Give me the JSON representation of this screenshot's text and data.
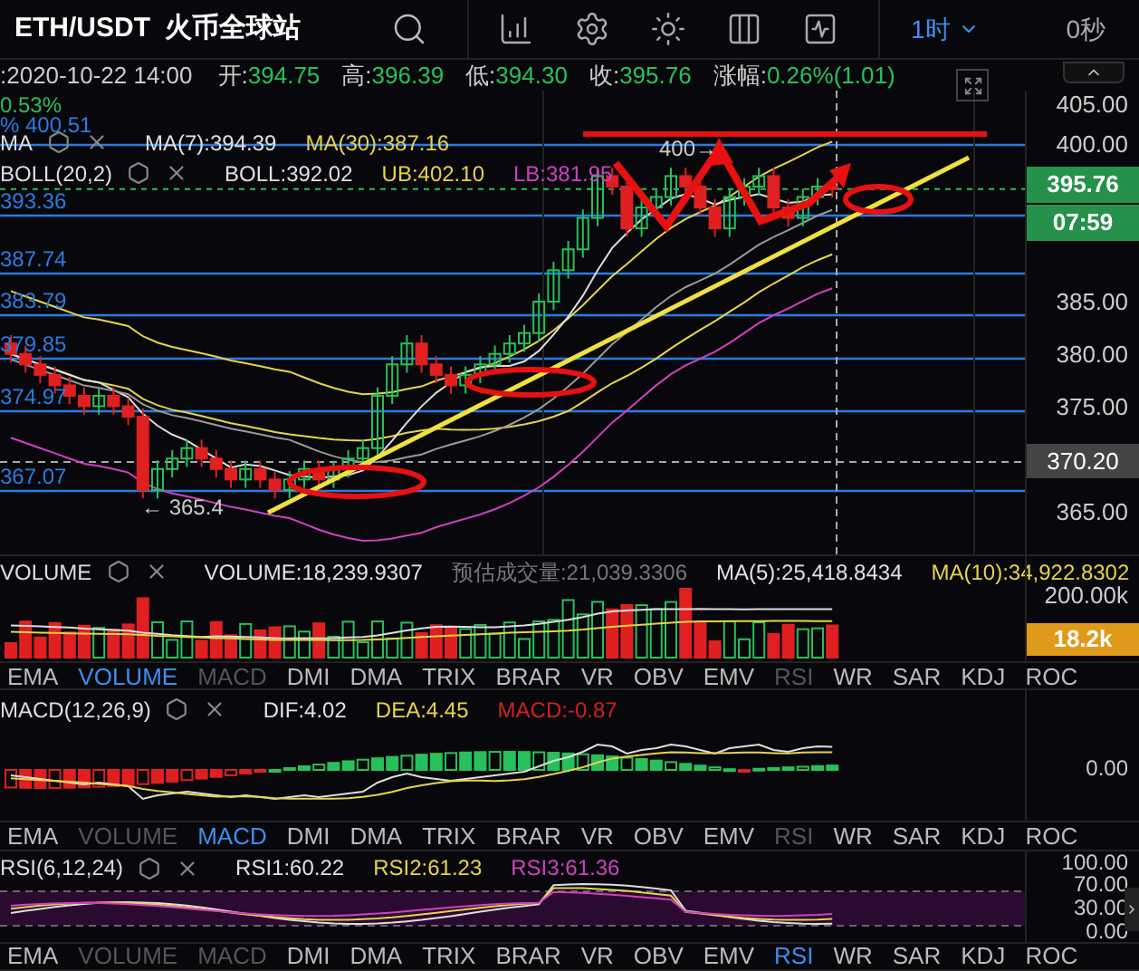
{
  "header": {
    "pair": "ETH/USDT",
    "exchange": "火币全球站",
    "interval": "1时",
    "countdown": "0秒"
  },
  "info": {
    "time": ":2020-10-22 14:00",
    "fields": [
      {
        "label": "开:",
        "value": "394.75"
      },
      {
        "label": "高:",
        "value": "396.39"
      },
      {
        "label": "低:",
        "value": "394.30"
      },
      {
        "label": "收:",
        "value": "395.76"
      },
      {
        "label": "涨幅:",
        "value": "0.26%(1.01)"
      }
    ]
  },
  "main": {
    "change": "0.53%",
    "fib_top": "% 400.51",
    "ma": {
      "name": "MA",
      "values": [
        {
          "text": "MA(7):394.39",
          "color": "#e0e0e0"
        },
        {
          "text": "MA(30):387.16",
          "color": "#e6d34a"
        }
      ]
    },
    "boll": {
      "name": "BOLL(20,2)",
      "values": [
        {
          "text": "BOLL:392.02",
          "color": "#e0e0e0"
        },
        {
          "text": "UB:402.10",
          "color": "#e6d34a"
        },
        {
          "text": "LB:381.95",
          "color": "#d040c0"
        }
      ]
    },
    "fib_levels": [
      "393.36",
      "387.74",
      "383.79",
      "379.85",
      "374.97",
      "367.07"
    ],
    "high_label": "400→",
    "low_label": "← 365.4",
    "price_axis": [
      "405.00",
      "400.00",
      "385.00",
      "380.00",
      "375.00",
      "365.00"
    ],
    "price_tag": "395.76",
    "countdown_tag": "07:59",
    "crosshair_tag": "370.20"
  },
  "volume": {
    "name": "VOLUME",
    "values": [
      {
        "text": "VOLUME:18,239.9307",
        "color": "#e0e0e0"
      },
      {
        "text": "预估成交量:21,039.3306",
        "color": "#777777"
      },
      {
        "text": "MA(5):25,418.8434",
        "color": "#e0e0e0"
      },
      {
        "text": "MA(10):34,922.8302",
        "color": "#e6d34a"
      }
    ],
    "axis": [
      "200.00k"
    ],
    "tag": "18.2k"
  },
  "tabs_1": [
    {
      "label": "EMA",
      "selected": false,
      "disabled": false
    },
    {
      "label": "VOLUME",
      "selected": true,
      "disabled": false
    },
    {
      "label": "MACD",
      "selected": false,
      "disabled": true
    },
    {
      "label": "DMI",
      "selected": false,
      "disabled": false
    },
    {
      "label": "DMA",
      "selected": false,
      "disabled": false
    },
    {
      "label": "TRIX",
      "selected": false,
      "disabled": false
    },
    {
      "label": "BRAR",
      "selected": false,
      "disabled": false
    },
    {
      "label": "VR",
      "selected": false,
      "disabled": false
    },
    {
      "label": "OBV",
      "selected": false,
      "disabled": false
    },
    {
      "label": "EMV",
      "selected": false,
      "disabled": false
    },
    {
      "label": "RSI",
      "selected": false,
      "disabled": true
    },
    {
      "label": "WR",
      "selected": false,
      "disabled": false
    },
    {
      "label": "SAR",
      "selected": false,
      "disabled": false
    },
    {
      "label": "KDJ",
      "selected": false,
      "disabled": false
    },
    {
      "label": "ROC",
      "selected": false,
      "disabled": false
    }
  ],
  "macd": {
    "name": "MACD(12,26,9)",
    "values": [
      {
        "text": "DIF:4.02",
        "color": "#e0e0e0"
      },
      {
        "text": "DEA:4.45",
        "color": "#e6d34a"
      },
      {
        "text": "MACD:-0.87",
        "color": "#d02020"
      }
    ],
    "axis": [
      "0.00"
    ]
  },
  "tabs_2": [
    {
      "label": "EMA",
      "selected": false,
      "disabled": false
    },
    {
      "label": "VOLUME",
      "selected": false,
      "disabled": true
    },
    {
      "label": "MACD",
      "selected": true,
      "disabled": false
    },
    {
      "label": "DMI",
      "selected": false,
      "disabled": false
    },
    {
      "label": "DMA",
      "selected": false,
      "disabled": false
    },
    {
      "label": "TRIX",
      "selected": false,
      "disabled": false
    },
    {
      "label": "BRAR",
      "selected": false,
      "disabled": false
    },
    {
      "label": "VR",
      "selected": false,
      "disabled": false
    },
    {
      "label": "OBV",
      "selected": false,
      "disabled": false
    },
    {
      "label": "EMV",
      "selected": false,
      "disabled": false
    },
    {
      "label": "RSI",
      "selected": false,
      "disabled": true
    },
    {
      "label": "WR",
      "selected": false,
      "disabled": false
    },
    {
      "label": "SAR",
      "selected": false,
      "disabled": false
    },
    {
      "label": "KDJ",
      "selected": false,
      "disabled": false
    },
    {
      "label": "ROC",
      "selected": false,
      "disabled": false
    }
  ],
  "rsi": {
    "name": "RSI(6,12,24)",
    "values": [
      {
        "text": "RSI1:60.22",
        "color": "#e0e0e0"
      },
      {
        "text": "RSI2:61.23",
        "color": "#e6d34a"
      },
      {
        "text": "RSI3:61.36",
        "color": "#d040c0"
      }
    ],
    "axis": [
      "100.00",
      "70.00",
      "30.00",
      "0.00"
    ]
  },
  "tabs_3": [
    {
      "label": "EMA",
      "selected": false,
      "disabled": false
    },
    {
      "label": "VOLUME",
      "selected": false,
      "disabled": true
    },
    {
      "label": "MACD",
      "selected": false,
      "disabled": true
    },
    {
      "label": "DMI",
      "selected": false,
      "disabled": false
    },
    {
      "label": "DMA",
      "selected": false,
      "disabled": false
    },
    {
      "label": "TRIX",
      "selected": false,
      "disabled": false
    },
    {
      "label": "BRAR",
      "selected": false,
      "disabled": false
    },
    {
      "label": "VR",
      "selected": false,
      "disabled": false
    },
    {
      "label": "OBV",
      "selected": false,
      "disabled": false
    },
    {
      "label": "EMV",
      "selected": false,
      "disabled": false
    },
    {
      "label": "RSI",
      "selected": true,
      "disabled": false
    },
    {
      "label": "WR",
      "selected": false,
      "disabled": false
    },
    {
      "label": "SAR",
      "selected": false,
      "disabled": false
    },
    {
      "label": "KDJ",
      "selected": false,
      "disabled": false
    },
    {
      "label": "ROC",
      "selected": false,
      "disabled": false
    }
  ]
}
